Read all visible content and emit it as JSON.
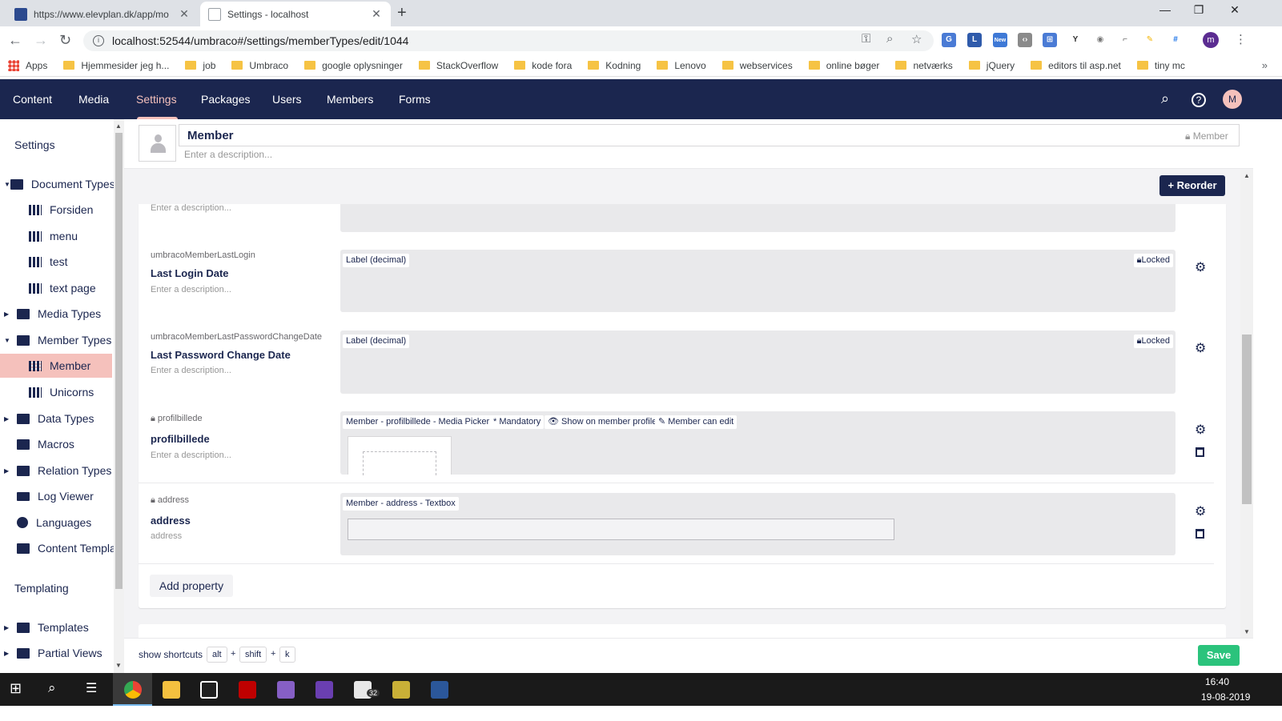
{
  "browser": {
    "tabs": [
      {
        "title": "https://www.elevplan.dk/app/mo",
        "active": false
      },
      {
        "title": "Settings - localhost",
        "active": true
      }
    ],
    "url": "localhost:52544/umbraco#/settings/memberTypes/edit/1044",
    "bookmarks": [
      "Apps",
      "Hjemmesider jeg h...",
      "job",
      "Umbraco",
      "google oplysninger",
      "StackOverflow",
      "kode fora",
      "Kodning",
      "Lenovo",
      "webservices",
      "online bøger",
      "netværks",
      "jQuery",
      "editors til asp.net",
      "tiny mc"
    ],
    "profile_initial": "m",
    "new_badge": "New"
  },
  "header": {
    "nav": [
      "Content",
      "Media",
      "Settings",
      "Packages",
      "Users",
      "Members",
      "Forms"
    ],
    "active": "Settings",
    "avatar": "M"
  },
  "sidebar": {
    "settings_title": "Settings",
    "templating_title": "Templating",
    "items": [
      {
        "label": "Document Types",
        "icon": "folder-icon",
        "level": 0,
        "expanded": true
      },
      {
        "label": "Forsiden",
        "icon": "grid-icon",
        "level": 1
      },
      {
        "label": "menu",
        "icon": "grid-icon",
        "level": 1
      },
      {
        "label": "test",
        "icon": "grid-icon",
        "level": 1
      },
      {
        "label": "text page",
        "icon": "grid-icon",
        "level": 1
      },
      {
        "label": "Media Types",
        "icon": "folder-icon",
        "level": 0,
        "expanded": false
      },
      {
        "label": "Member Types",
        "icon": "folder-icon",
        "level": 0,
        "expanded": true
      },
      {
        "label": "Member",
        "icon": "grid-icon",
        "level": 1,
        "selected": true
      },
      {
        "label": "Unicorns",
        "icon": "grid-icon",
        "level": 1
      },
      {
        "label": "Data Types",
        "icon": "folder-icon",
        "level": 0,
        "expanded": false
      },
      {
        "label": "Macros",
        "icon": "folder-icon",
        "level": 0
      },
      {
        "label": "Relation Types",
        "icon": "folder-icon",
        "level": 0,
        "expanded": false
      },
      {
        "label": "Log Viewer",
        "icon": "box-icon",
        "level": 0
      },
      {
        "label": "Languages",
        "icon": "globe-icon",
        "level": 0
      },
      {
        "label": "Content Templates",
        "icon": "folder-icon",
        "level": 0
      }
    ],
    "templating_items": [
      {
        "label": "Templates",
        "icon": "folder-icon"
      },
      {
        "label": "Partial Views",
        "icon": "folder-icon"
      }
    ]
  },
  "editor": {
    "name": "Member",
    "alias": "Member",
    "description_placeholder": "Enter a description...",
    "reorder_label": "Reorder"
  },
  "properties": [
    {
      "alias": "umbracoMemberLastLogin",
      "label": "Last Login Date",
      "description": "Enter a description...",
      "tags": [
        "Label (decimal)"
      ],
      "locked": "Locked"
    },
    {
      "alias": "umbracoMemberLastPasswordChangeDate",
      "label": "Last Password Change Date",
      "description": "Enter a description...",
      "tags": [
        "Label (decimal)"
      ],
      "locked": "Locked"
    },
    {
      "alias": "profilbillede",
      "label": "profilbillede",
      "description": "Enter a description...",
      "tags": [
        "Member - profilbillede - Media Picker",
        "* Mandatory",
        "Show on member profile",
        "Member can edit"
      ]
    },
    {
      "alias": "address",
      "label": "address",
      "description": "address",
      "tags": [
        "Member - address - Textbox"
      ]
    }
  ],
  "partial_top_description": "Enter a description...",
  "add_property_label": "Add property",
  "footer": {
    "shortcuts_label": "show shortcuts",
    "keys": [
      "alt",
      "shift",
      "k"
    ],
    "plus": "+",
    "save_label": "Save"
  },
  "taskbar": {
    "time": "16:40",
    "date": "19-08-2019",
    "badge": "32"
  }
}
